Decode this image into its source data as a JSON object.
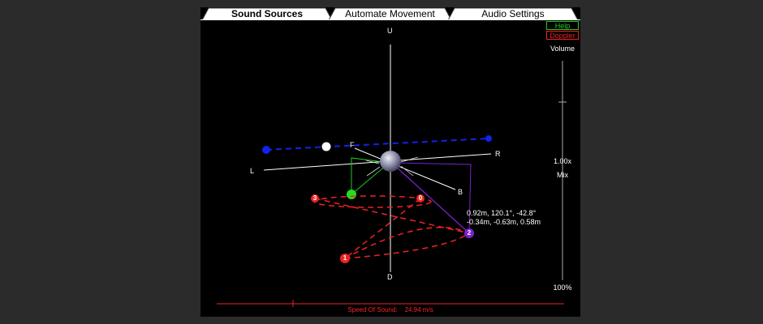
{
  "tabs": [
    {
      "label": "Sound Sources",
      "active": true
    },
    {
      "label": "Automate Movement",
      "active": false
    },
    {
      "label": "Audio Settings",
      "active": false
    }
  ],
  "buttons": {
    "help": "Help",
    "doppler": "Doppler"
  },
  "axes": {
    "up": "U",
    "down": "D",
    "left": "L",
    "right": "R",
    "front": "F",
    "back": "B"
  },
  "side_slider": {
    "title": "Volume",
    "value": "1.00x",
    "mix_label": "Mix",
    "mix_value": "100%"
  },
  "source_info": {
    "line1": "0.92m, 120.1°, -42.8°",
    "line2": "-0.34m, -0.63m, 0.58m"
  },
  "speed_of_sound": {
    "label": "Speed Of Sound:",
    "value": "24.94 m/s"
  },
  "sources": [
    {
      "id": "3",
      "color": "#ee2222"
    },
    {
      "id": "0",
      "color": "#ee2222"
    },
    {
      "id": "2",
      "color": "#7a22cc"
    },
    {
      "id": "1",
      "color": "#ee2222"
    }
  ],
  "colors": {
    "accent_red": "#ee2222",
    "accent_green": "#22cc22",
    "accent_blue": "#1122ee",
    "accent_purple": "#7a22cc"
  }
}
